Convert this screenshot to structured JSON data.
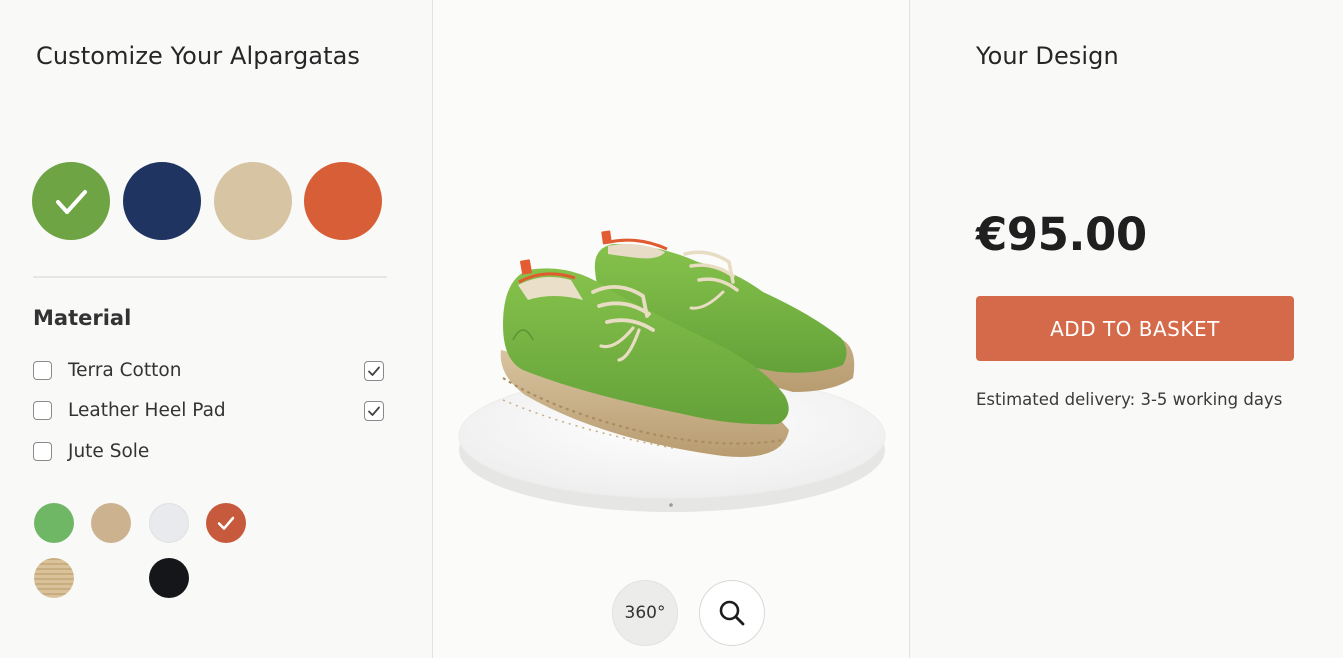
{
  "left_panel": {
    "title": "Customize Your Alpargatas",
    "colors": [
      {
        "name": "green",
        "hex": "#6ea444",
        "selected": true
      },
      {
        "name": "navy",
        "hex": "#1f3461",
        "selected": false
      },
      {
        "name": "beige",
        "hex": "#d6c4a3",
        "selected": false
      },
      {
        "name": "orange",
        "hex": "#d85e38",
        "selected": false
      }
    ],
    "material_heading": "Material",
    "materials": [
      {
        "label": "Terra Cotton",
        "checked": false,
        "right_checked": true
      },
      {
        "label": "Leather Heel Pad",
        "checked": false,
        "right_checked": true
      },
      {
        "label": "Jute Sole",
        "checked": false,
        "right_checked": false
      }
    ],
    "accent_swatches": [
      {
        "name": "green",
        "hex": "#6fb765",
        "selected": false
      },
      {
        "name": "tan",
        "hex": "#cdb290",
        "selected": false
      },
      {
        "name": "white",
        "hex": "#e8eaee",
        "selected": false
      },
      {
        "name": "orange",
        "hex": "#c75a3c",
        "selected": true
      },
      {
        "name": "jute",
        "hex": "#d9c29a",
        "selected": false
      },
      {
        "name": "black",
        "hex": "#15161a",
        "selected": false
      }
    ]
  },
  "viewer": {
    "rotate_label": "360°",
    "zoom_icon": "search-icon"
  },
  "right_panel": {
    "title": "Your Design",
    "price": "€95.00",
    "cta": "ADD TO BASKET",
    "delivery": "Estimated delivery: 3-5 working days"
  },
  "colors": {
    "accent": "#d56a4a",
    "shoe_green": "#7dbb45"
  }
}
